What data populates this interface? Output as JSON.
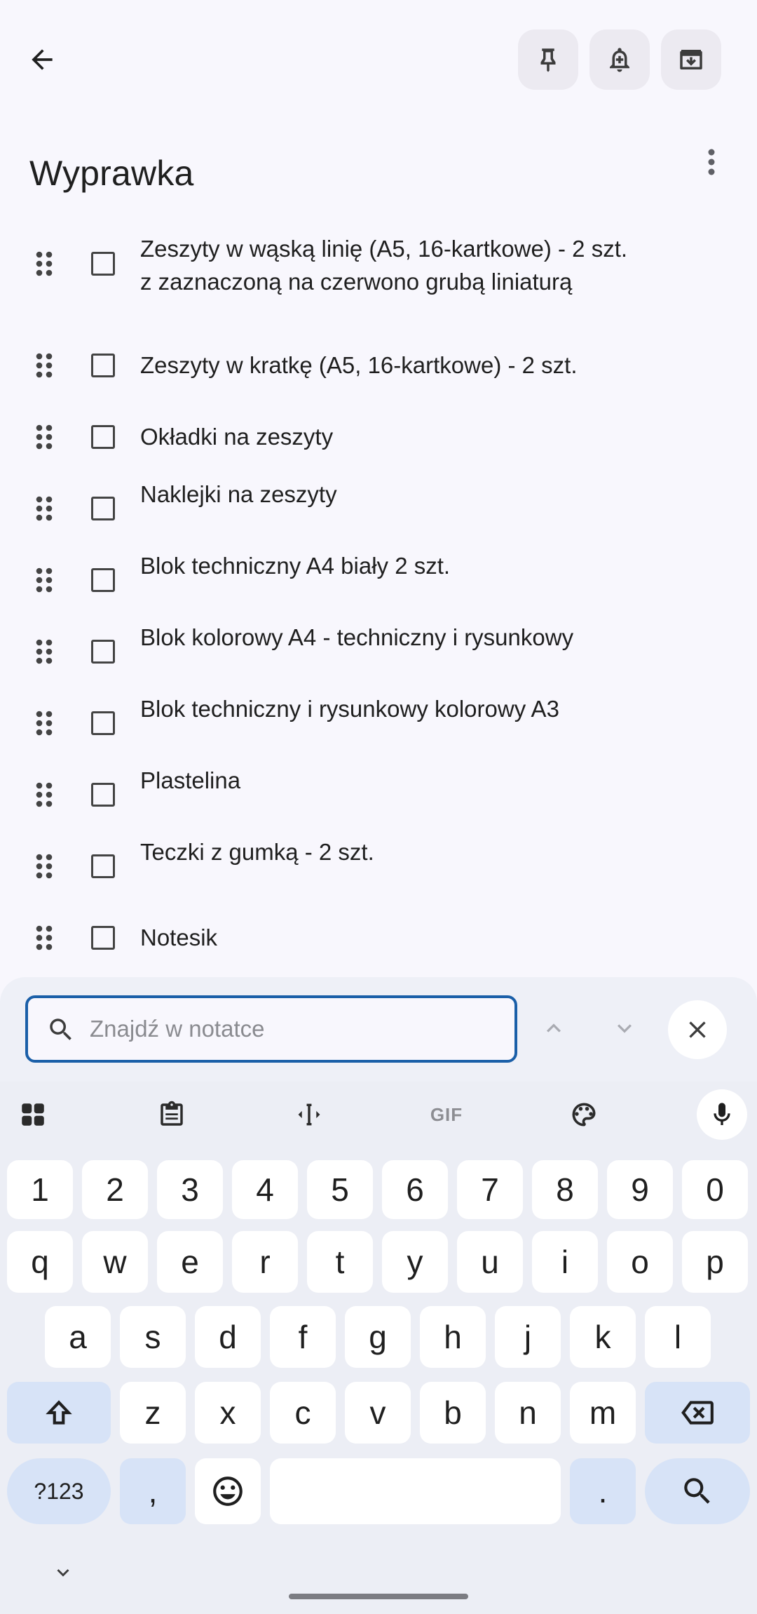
{
  "top_bar": {
    "back_icon": "arrow-back-icon",
    "actions": [
      "pin-icon",
      "reminder-bell-icon",
      "archive-icon"
    ]
  },
  "note": {
    "title": "Wyprawka",
    "items": [
      {
        "text": "Zeszyty w wąską linię (A5, 16-kartkowe) - 2 szt.\nz zaznaczoną na czerwono grubą liniaturą",
        "checked": false
      },
      {
        "text": "Zeszyty w kratkę (A5, 16-kartkowe) - 2 szt.",
        "checked": false
      },
      {
        "text": "Okładki na zeszyty",
        "checked": false
      },
      {
        "text": "Naklejki na zeszyty",
        "checked": false
      },
      {
        "text": "Blok techniczny A4 biały 2 szt.",
        "checked": false
      },
      {
        "text": "Blok kolorowy A4 - techniczny i rysunkowy",
        "checked": false
      },
      {
        "text": "Blok techniczny i rysunkowy kolorowy A3",
        "checked": false
      },
      {
        "text": "Plastelina",
        "checked": false
      },
      {
        "text": "Teczki z gumką - 2 szt.",
        "checked": false
      },
      {
        "text": "Notesik",
        "checked": false
      }
    ]
  },
  "find_bar": {
    "placeholder": "Znajdź w notatce",
    "value": ""
  },
  "keyboard": {
    "toolbar": [
      "apps-grid-icon",
      "clipboard-icon",
      "text-cursor-icon",
      "gif-icon",
      "palette-icon",
      "mic-icon"
    ],
    "gif_label": "GIF",
    "row_numbers": [
      "1",
      "2",
      "3",
      "4",
      "5",
      "6",
      "7",
      "8",
      "9",
      "0"
    ],
    "row1": [
      "q",
      "w",
      "e",
      "r",
      "t",
      "y",
      "u",
      "i",
      "o",
      "p"
    ],
    "row2": [
      "a",
      "s",
      "d",
      "f",
      "g",
      "h",
      "j",
      "k",
      "l"
    ],
    "row3": [
      "z",
      "x",
      "c",
      "v",
      "b",
      "n",
      "m"
    ],
    "symbols_label": "?123",
    "comma_label": ",",
    "period_label": "."
  },
  "colors": {
    "accent": "#1a5fa8",
    "background": "#f8f7fd",
    "modifier_key": "#d7e3f7"
  }
}
